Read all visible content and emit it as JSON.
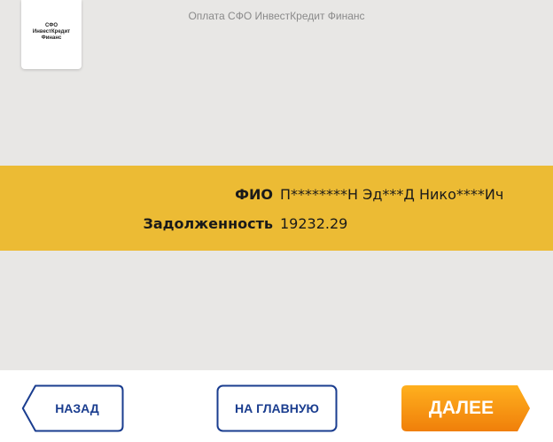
{
  "logo": {
    "line1": "СФО",
    "line2": "ИнвестКредит",
    "line3": "Финанс"
  },
  "header": {
    "title": "Оплата СФО ИнвестКредит Финанс"
  },
  "info": {
    "fio_label": "ФИО",
    "fio_value": "П********Н Эд***Д Нико****Ич",
    "debt_label": "Задолженность",
    "debt_value": "19232.29"
  },
  "buttons": {
    "back": "НАЗАД",
    "home": "НА ГЛАВНУЮ",
    "next": "ДАЛЕЕ"
  },
  "colors": {
    "background": "#e8e7e5",
    "band": "#ecbb34",
    "button_border": "#1a3d8f",
    "next_gradient_top": "#ffb01e",
    "next_gradient_bottom": "#f07f0a"
  }
}
